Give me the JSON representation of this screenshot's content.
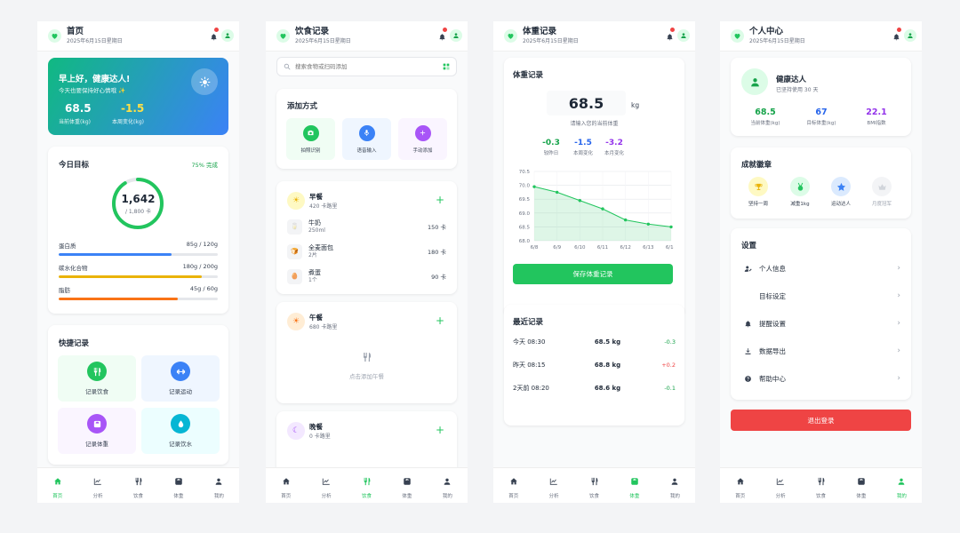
{
  "common": {
    "date": "2025年6月15日星期日"
  },
  "nav": [
    {
      "label": "首页"
    },
    {
      "label": "分析"
    },
    {
      "label": "饮食"
    },
    {
      "label": "体重"
    },
    {
      "label": "我的"
    }
  ],
  "home": {
    "title": "首页",
    "greeting": "早上好，健康达人!",
    "subtitle": "今天也要保持好心情哦 ✨",
    "weight_value": "68.5",
    "weight_label": "当前体重(kg)",
    "change_value": "-1.5",
    "change_label": "本周变化(kg)",
    "goal_title": "今日目标",
    "goal_percent": "75% 完成",
    "goal_progress": 0.91,
    "kcal_value": "1,642",
    "kcal_total": "/ 1,800 卡",
    "macros": [
      {
        "name": "蛋白质",
        "value": "85g / 120g",
        "progress": 0.71,
        "color": "#3b82f6"
      },
      {
        "name": "碳水化合物",
        "value": "180g / 200g",
        "progress": 0.9,
        "color": "#eab308"
      },
      {
        "name": "脂肪",
        "value": "45g / 60g",
        "progress": 0.75,
        "color": "#f97316"
      }
    ],
    "quick_title": "快捷记录",
    "quick": [
      {
        "label": "记录饮食",
        "color": "#22c55e",
        "bg": "#f0fdf4"
      },
      {
        "label": "记录运动",
        "color": "#3b82f6",
        "bg": "#eff6ff"
      },
      {
        "label": "记录体重",
        "color": "#a855f7",
        "bg": "#faf5ff"
      },
      {
        "label": "记录饮水",
        "color": "#06b6d4",
        "bg": "#ecfeff"
      }
    ]
  },
  "diet": {
    "title": "饮食记录",
    "search_placeholder": "搜索食物或扫码添加",
    "add_title": "添加方式",
    "methods": [
      {
        "label": "拍照识别",
        "color": "#22c55e",
        "bg": "#f0fdf4"
      },
      {
        "label": "语音输入",
        "color": "#3b82f6",
        "bg": "#eff6ff"
      },
      {
        "label": "手动添加",
        "color": "#a855f7",
        "bg": "#faf5ff"
      }
    ],
    "breakfast": {
      "name": "早餐",
      "kcal": "420 卡路里",
      "items": [
        {
          "name": "牛奶",
          "qty": "250ml",
          "kcal": "150 卡"
        },
        {
          "name": "全麦面包",
          "qty": "2片",
          "kcal": "180 卡"
        },
        {
          "name": "煮蛋",
          "qty": "1个",
          "kcal": "90 卡"
        }
      ]
    },
    "lunch": {
      "name": "午餐",
      "kcal": "680 卡路里",
      "empty": "点击添加午餐"
    },
    "dinner": {
      "name": "晚餐",
      "kcal": "0 卡路里"
    }
  },
  "weight": {
    "title": "体重记录",
    "card_title": "体重记录",
    "input_value": "68.5",
    "unit": "kg",
    "hint": "请输入您的当前体重",
    "stats": [
      {
        "value": "-0.3",
        "label": "较昨日",
        "color": "#16a34a"
      },
      {
        "value": "-1.5",
        "label": "本周变化",
        "color": "#2563eb"
      },
      {
        "value": "-3.2",
        "label": "本月变化",
        "color": "#9333ea"
      }
    ],
    "save_label": "保存体重记录",
    "recent_title": "最近记录",
    "records": [
      {
        "time": "今天 08:30",
        "weight": "68.5 kg",
        "diff": "-0.3",
        "color": "#16a34a"
      },
      {
        "time": "昨天 08:15",
        "weight": "68.8 kg",
        "diff": "+0.2",
        "color": "#ef4444"
      },
      {
        "time": "2天前 08:20",
        "weight": "68.6 kg",
        "diff": "-0.1",
        "color": "#16a34a"
      }
    ]
  },
  "chart_data": {
    "type": "area",
    "x": [
      "6/8",
      "6/9",
      "6/10",
      "6/11",
      "6/12",
      "6/13",
      "6/14"
    ],
    "values": [
      69.95,
      69.75,
      69.45,
      69.15,
      68.75,
      68.6,
      68.5
    ],
    "yticks": [
      "70.5",
      "70.0",
      "69.5",
      "69.0",
      "68.5",
      "68.0"
    ],
    "ylim": [
      68.0,
      70.5
    ],
    "grid": true,
    "color": "#22c55e"
  },
  "profile": {
    "title": "个人中心",
    "name": "健康达人",
    "days": "已坚持使用 30 天",
    "stats": [
      {
        "value": "68.5",
        "label": "当前体重(kg)",
        "color": "#16a34a"
      },
      {
        "value": "67",
        "label": "目标体重(kg)",
        "color": "#2563eb"
      },
      {
        "value": "22.1",
        "label": "BMI指数",
        "color": "#9333ea"
      }
    ],
    "ach_title": "成就徽章",
    "achievements": [
      {
        "label": "坚持一周",
        "bg": "#fef9c3",
        "color": "#eab308"
      },
      {
        "label": "减重1kg",
        "bg": "#dcfce7",
        "color": "#22c55e"
      },
      {
        "label": "运动达人",
        "bg": "#dbeafe",
        "color": "#3b82f6"
      },
      {
        "label": "月度冠军",
        "bg": "#f3f4f6",
        "color": "#d1d5db"
      }
    ],
    "settings_title": "设置",
    "settings": [
      {
        "label": "个人信息"
      },
      {
        "label": "目标设定"
      },
      {
        "label": "提醒设置"
      },
      {
        "label": "数据导出"
      },
      {
        "label": "帮助中心"
      }
    ],
    "logout": "退出登录"
  }
}
